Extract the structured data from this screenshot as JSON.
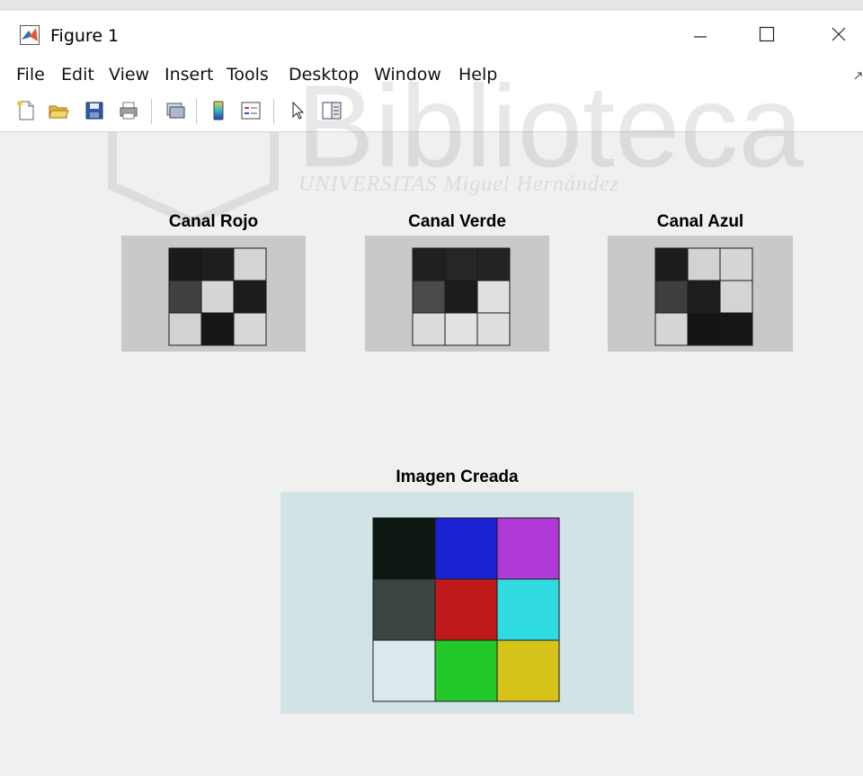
{
  "window": {
    "title": "Figure 1"
  },
  "menu": [
    "File",
    "Edit",
    "View",
    "Insert",
    "Tools",
    "Desktop",
    "Window",
    "Help"
  ],
  "toolbar_icons": [
    "new-figure-icon",
    "open-file-icon",
    "save-icon",
    "print-icon",
    "link-figure-icon",
    "insert-colorbar-icon",
    "insert-legend-icon",
    "pointer-icon",
    "property-editor-icon"
  ],
  "watermark": {
    "line1": "Biblioteca",
    "line2": "UNIVERSITAS Miguel Hernández"
  },
  "axes": [
    {
      "title": "Canal Rojo",
      "cells": [
        "#1b1b1b",
        "#1e1e1e",
        "#d4d4d4",
        "#404040",
        "#d6d6d6",
        "#1c1c1c",
        "#d2d2d2",
        "#161616",
        "#d8d8d8"
      ]
    },
    {
      "title": "Canal Verde",
      "cells": [
        "#202020",
        "#262626",
        "#232323",
        "#4a4a4a",
        "#1c1c1c",
        "#e0e0e0",
        "#dcdcdc",
        "#e2e2e2",
        "#dedede"
      ]
    },
    {
      "title": "Canal Azul",
      "cells": [
        "#1d1d1d",
        "#d2d2d2",
        "#d6d6d6",
        "#3e3e3e",
        "#1e1e1e",
        "#d4d4d4",
        "#d6d6d6",
        "#141414",
        "#161616"
      ]
    }
  ],
  "main_axis": {
    "title": "Imagen Creada",
    "cells": [
      "#0b1710",
      "#1a22d4",
      "#b13ad6",
      "#3b4542",
      "#c0191c",
      "#2fdae0",
      "#dde8ee",
      "#22c72a",
      "#d5c319"
    ]
  },
  "colors": {
    "background": "#f0f0f0",
    "photo_background_gray": "#c9c9c9",
    "photo_background_main": "#d2e3e6"
  }
}
